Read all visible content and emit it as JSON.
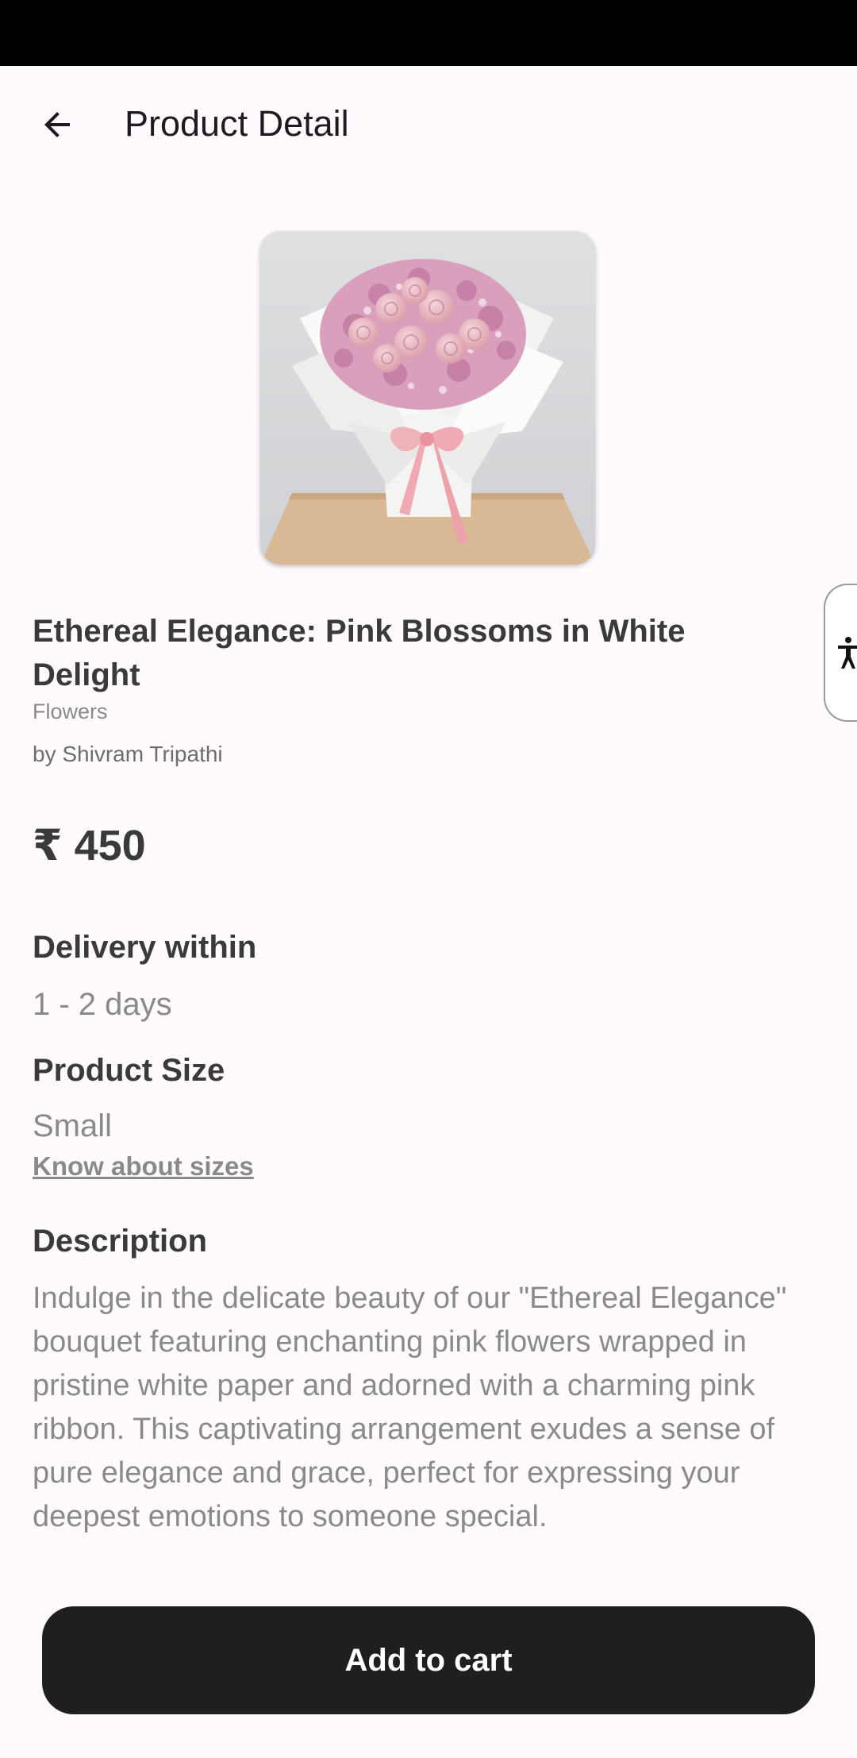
{
  "header": {
    "back_icon": "arrow-left-icon",
    "title": "Product Detail"
  },
  "product": {
    "name": "Ethereal Elegance: Pink Blossoms in White Delight",
    "category": "Flowers",
    "seller": "by Shivram Tripathi",
    "price": "₹ 450"
  },
  "delivery": {
    "heading": "Delivery within",
    "value": "1 - 2 days"
  },
  "size": {
    "heading": "Product Size",
    "value": "Small",
    "link": "Know about sizes"
  },
  "description": {
    "heading": "Description",
    "text": "Indulge in the delicate beauty of our \"Ethereal Elegance\" bouquet featuring enchanting pink flowers wrapped in pristine white paper and adorned with a charming pink ribbon. This captivating arrangement exudes a sense of pure elegance and grace, perfect for expressing your deepest emotions to someone special."
  },
  "actions": {
    "add_to_cart": "Add to cart"
  },
  "accessibility": {
    "icon": "accessibility-icon"
  },
  "colors": {
    "button_background": "#1f1e20",
    "page_background": "#fefafe"
  }
}
